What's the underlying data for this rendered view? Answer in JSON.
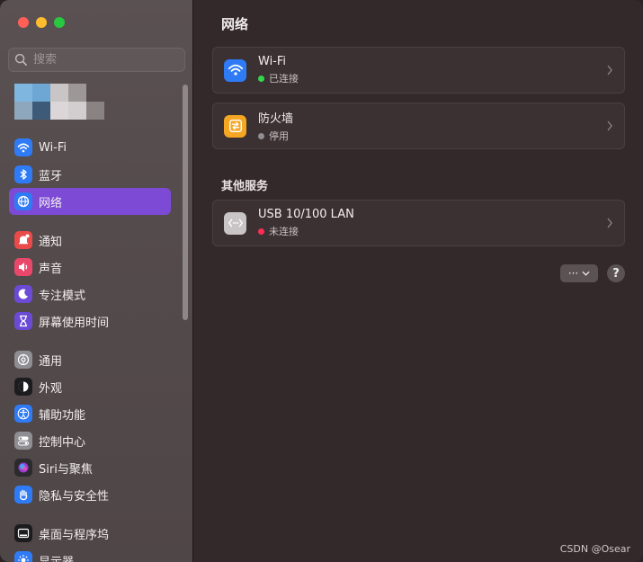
{
  "search": {
    "placeholder": "搜索"
  },
  "sidebar": {
    "groups": [
      [
        {
          "id": "wifi",
          "label": "Wi-Fi",
          "icon": "wifi-icon",
          "color": "#2f7bf6"
        },
        {
          "id": "bluetooth",
          "label": "蓝牙",
          "icon": "bluetooth-icon",
          "color": "#2f7bf6"
        },
        {
          "id": "network",
          "label": "网络",
          "icon": "globe-icon",
          "color": "#2f7bf6",
          "active": true
        }
      ],
      [
        {
          "id": "notifications",
          "label": "通知",
          "icon": "bell-icon",
          "color": "#e94a4a"
        },
        {
          "id": "sound",
          "label": "声音",
          "icon": "speaker-icon",
          "color": "#e9486a"
        },
        {
          "id": "focus",
          "label": "专注模式",
          "icon": "moon-icon",
          "color": "#6b4bd6"
        },
        {
          "id": "screentime",
          "label": "屏幕使用时间",
          "icon": "hourglass-icon",
          "color": "#6b4bd6"
        }
      ],
      [
        {
          "id": "general",
          "label": "通用",
          "icon": "gear-icon",
          "color": "#8f8f93"
        },
        {
          "id": "appearance",
          "label": "外观",
          "icon": "appearance-icon",
          "color": "#1c1c1e"
        },
        {
          "id": "accessibility",
          "label": "辅助功能",
          "icon": "accessibility-icon",
          "color": "#2f7bf6"
        },
        {
          "id": "control",
          "label": "控制中心",
          "icon": "toggles-icon",
          "color": "#8f8f93"
        },
        {
          "id": "siri",
          "label": "Siri与聚焦",
          "icon": "siri-icon",
          "color": "#2b2b2e"
        },
        {
          "id": "privacy",
          "label": "隐私与安全性",
          "icon": "hand-icon",
          "color": "#2f7bf6"
        }
      ],
      [
        {
          "id": "desktop",
          "label": "桌面与程序坞",
          "icon": "dock-icon",
          "color": "#1c1c1e"
        },
        {
          "id": "display",
          "label": "显示器",
          "icon": "sun-icon",
          "color": "#2f7bf6"
        }
      ]
    ]
  },
  "main": {
    "title": "网络",
    "wifi": {
      "title": "Wi-Fi",
      "status": "已连接",
      "status_color": "#32d74b"
    },
    "firewall": {
      "title": "防火墙",
      "status": "停用",
      "status_color": "#8e8e93"
    },
    "section_title": "其他服务",
    "usb": {
      "title": "USB 10/100 LAN",
      "status": "未连接",
      "status_color": "#ff2d55"
    },
    "more_label": "···",
    "help_label": "?"
  },
  "watermark": "CSDN @Osear"
}
